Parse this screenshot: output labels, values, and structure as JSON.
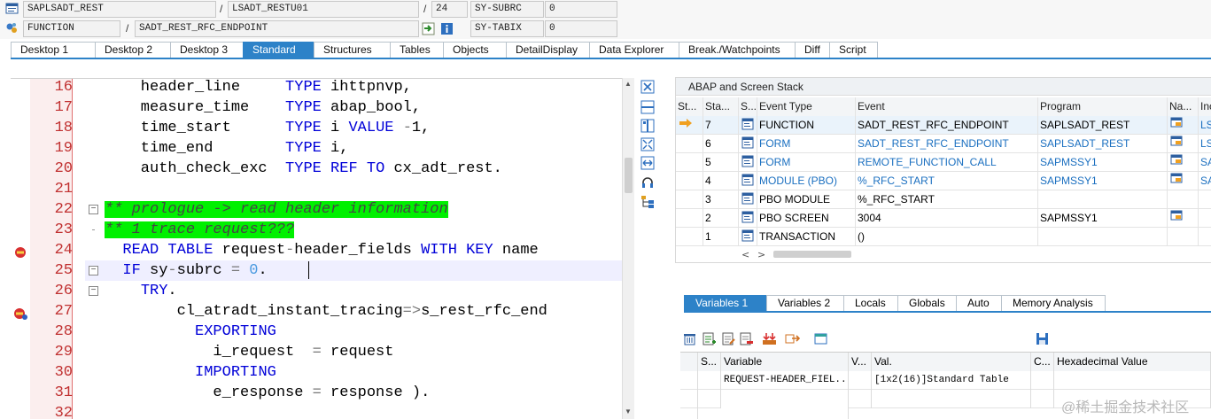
{
  "header": {
    "program": "SAPLSADT_REST",
    "include": "LSADT_RESTU01",
    "line": "24",
    "sy_subrc_label": "SY-SUBRC",
    "sy_subrc_value": "0",
    "event_type": "FUNCTION",
    "event_name": "SADT_REST_RFC_ENDPOINT",
    "sy_tabix_label": "SY-TABIX",
    "sy_tabix_value": "0",
    "slash": "/"
  },
  "tabs": [
    "Desktop 1",
    "Desktop 2",
    "Desktop 3",
    "Standard",
    "Structures",
    "Tables",
    "Objects",
    "DetailDisplay",
    "Data Explorer",
    "Break./Watchpoints",
    "Diff",
    "Script"
  ],
  "active_tab": "Standard",
  "code_lines": [
    {
      "n": "16",
      "text": "    header_line     TYPE ihttpnvp,"
    },
    {
      "n": "17",
      "text": "    measure_time    TYPE abap_bool,"
    },
    {
      "n": "18",
      "text": "    time_start      TYPE i VALUE -1,"
    },
    {
      "n": "19",
      "text": "    time_end        TYPE i,"
    },
    {
      "n": "20",
      "text": "    auth_check_exc  TYPE REF TO cx_adt_rest."
    },
    {
      "n": "21",
      "text": ""
    },
    {
      "n": "22",
      "text": "** prologue -> read header information"
    },
    {
      "n": "23",
      "text": "** 1 trace request???"
    },
    {
      "n": "24",
      "text": "  READ TABLE request-header_fields WITH KEY name"
    },
    {
      "n": "25",
      "text": "  IF sy-subrc = 0."
    },
    {
      "n": "26",
      "text": "    TRY."
    },
    {
      "n": "27",
      "text": "        cl_atradt_instant_tracing=>s_rest_rfc_end"
    },
    {
      "n": "28",
      "text": "          EXPORTING"
    },
    {
      "n": "29",
      "text": "            i_request  = request"
    },
    {
      "n": "30",
      "text": "          IMPORTING"
    },
    {
      "n": "31",
      "text": "            e_response = response )."
    },
    {
      "n": "32",
      "text": ""
    }
  ],
  "stack": {
    "title": "ABAP and Screen Stack",
    "columns": [
      "St...",
      "Sta...",
      "S...",
      "Event Type",
      "Event",
      "Program",
      "Na...",
      "Incl"
    ],
    "rows": [
      {
        "level": "7",
        "type": "FUNCTION",
        "event": "SADT_REST_RFC_ENDPOINT",
        "program": "SAPLSADT_REST",
        "incl": "LSA",
        "current": true,
        "link": false
      },
      {
        "level": "6",
        "type": "FORM",
        "event": "SADT_REST_RFC_ENDPOINT",
        "program": "SAPLSADT_REST",
        "incl": "LSA",
        "current": false,
        "link": true
      },
      {
        "level": "5",
        "type": "FORM",
        "event": "REMOTE_FUNCTION_CALL",
        "program": "SAPMSSY1",
        "incl": "SAP",
        "current": false,
        "link": true
      },
      {
        "level": "4",
        "type": "MODULE (PBO)",
        "event": "%_RFC_START",
        "program": "SAPMSSY1",
        "incl": "SAP",
        "current": false,
        "link": true
      },
      {
        "level": "3",
        "type": "PBO MODULE",
        "event": "%_RFC_START",
        "program": "",
        "incl": "",
        "current": false,
        "link": false
      },
      {
        "level": "2",
        "type": "PBO SCREEN",
        "event": "3004",
        "program": "SAPMSSY1",
        "incl": "",
        "current": false,
        "link": false
      },
      {
        "level": "1",
        "type": "TRANSACTION",
        "event": "()",
        "program": "",
        "incl": "",
        "current": false,
        "link": false
      }
    ]
  },
  "variables": {
    "tabs": [
      "Variables 1",
      "Variables 2",
      "Locals",
      "Globals",
      "Auto",
      "Memory Analysis"
    ],
    "active_tab": "Variables 1",
    "columns": [
      "S...",
      "Variable",
      "V...",
      "Val.",
      "C...",
      "Hexadecimal Value"
    ],
    "rows": [
      {
        "variable": "REQUEST-HEADER_FIEL...",
        "value": "[1x2(16)]Standard Table",
        "hex": ""
      }
    ]
  },
  "watermark": "@稀土掘金技术社区",
  "colors": {
    "accent": "#2d82c8",
    "keyword": "#0000d8",
    "comment_bg": "#00f000",
    "line_number": "#c03030"
  }
}
